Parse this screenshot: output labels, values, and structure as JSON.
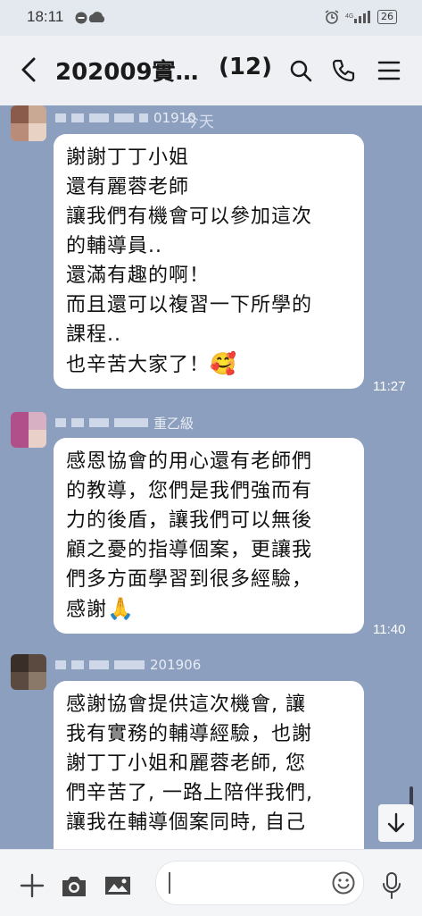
{
  "status_bar": {
    "time": "18:11",
    "battery": "26"
  },
  "header": {
    "title": "202009實…",
    "member_count": "(12)"
  },
  "today_chip": "今天",
  "messages": [
    {
      "sender_visible": "01910",
      "text": "謝謝丁丁小姐\n還有麗蓉老師\n讓我們有機會可以參加這次\n的輔導員..\n還滿有趣的啊！\n而且還可以複習一下所學的\n課程..\n也辛苦大家了！",
      "emoji": "🥰",
      "time": "11:27"
    },
    {
      "sender_visible": "重乙級",
      "text": "感恩協會的用心還有老師們\n的教導，您們是我們強而有\n力的後盾，讓我們可以無後\n顧之憂的指導個案，更讓我\n們多方面學習到很多經驗，\n感謝",
      "emoji": "🙏",
      "time": "11:40"
    },
    {
      "sender_visible": "201906",
      "text": "感謝協會提供這次機會, 讓\n我有實務的輔導經驗，也謝\n謝丁丁小姐和麗蓉老師, 您\n們辛苦了, 一路上陪伴我們,\n讓我在輔導個案同時, 自己",
      "emoji": "",
      "time": ""
    }
  ],
  "input": {
    "placeholder": ""
  },
  "colors": {
    "chat_bg": "#8c9fbf",
    "bubble": "#ffffff",
    "header_bg": "#eef0f4"
  }
}
